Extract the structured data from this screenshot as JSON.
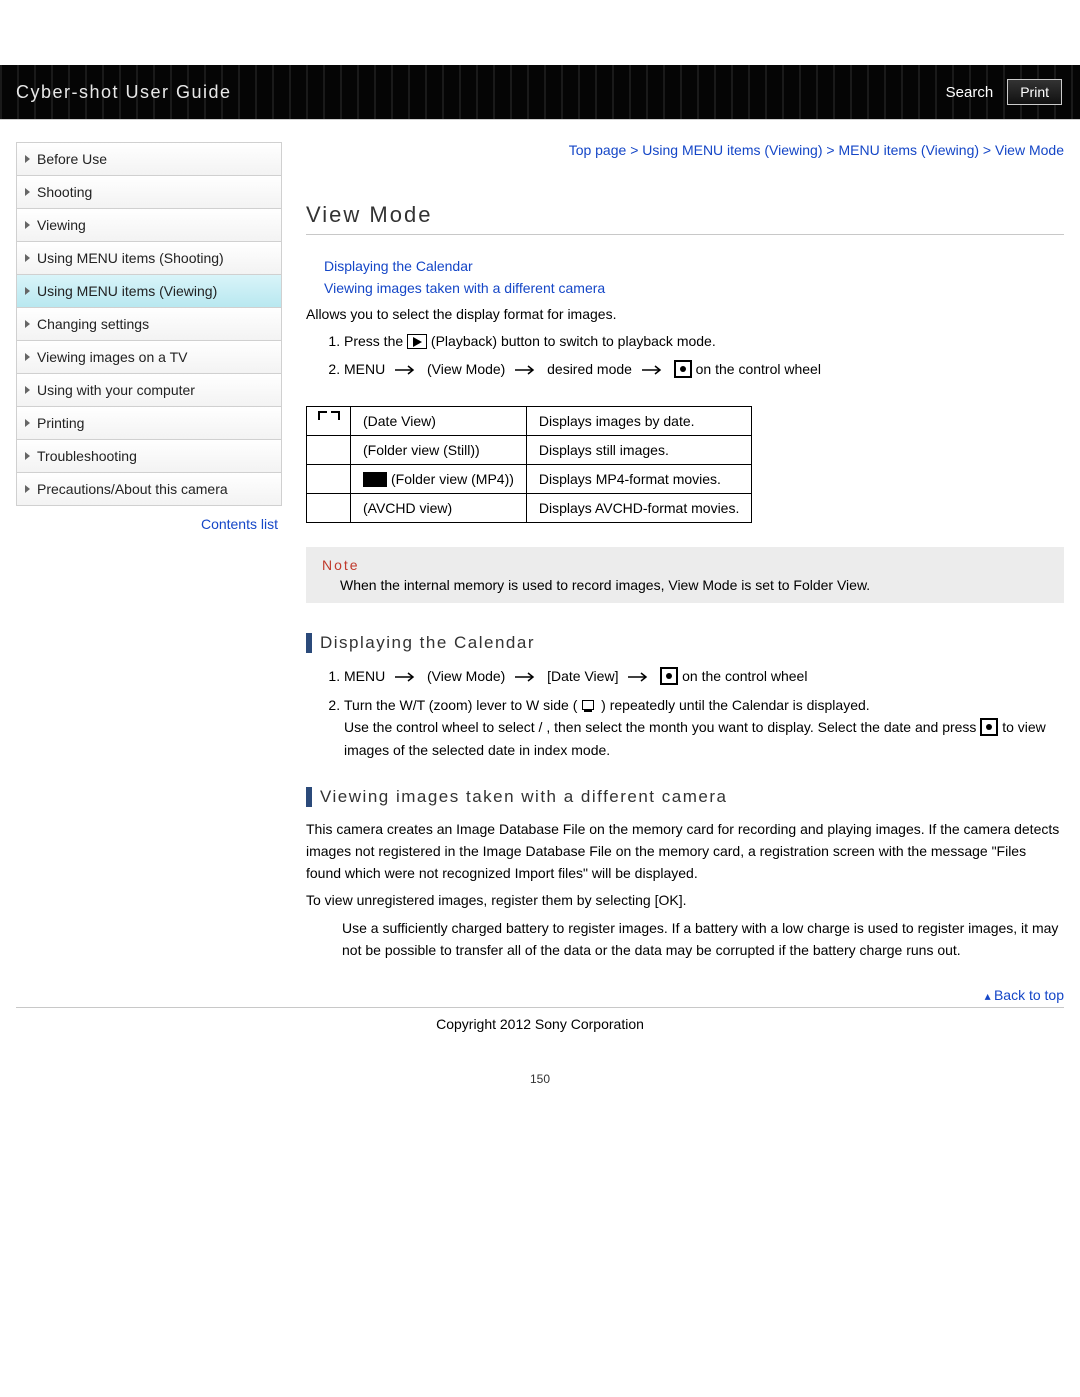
{
  "header": {
    "title": "Cyber-shot User Guide",
    "search": "Search",
    "print": "Print"
  },
  "breadcrumb": {
    "items": [
      "Top page",
      "Using MENU items (Viewing)",
      "MENU items (Viewing)",
      "View Mode"
    ]
  },
  "sidebar": {
    "items": [
      {
        "label": "Before Use",
        "active": false
      },
      {
        "label": "Shooting",
        "active": false
      },
      {
        "label": "Viewing",
        "active": false
      },
      {
        "label": "Using MENU items (Shooting)",
        "active": false
      },
      {
        "label": "Using MENU items (Viewing)",
        "active": true
      },
      {
        "label": "Changing settings",
        "active": false
      },
      {
        "label": "Viewing images on a TV",
        "active": false
      },
      {
        "label": "Using with your computer",
        "active": false
      },
      {
        "label": "Printing",
        "active": false
      },
      {
        "label": "Troubleshooting",
        "active": false
      },
      {
        "label": "Precautions/About this camera",
        "active": false
      }
    ],
    "contents_list": "Contents list"
  },
  "page_title": "View Mode",
  "anchors": {
    "a1": "Displaying the Calendar",
    "a2": "Viewing images taken with a different camera"
  },
  "intro": "Allows you to select the display format for images.",
  "steps_main": {
    "s1_a": "Press the ",
    "s1_b": " (Playback) button to switch to playback mode.",
    "s2_a": "MENU ",
    "s2_b": " (View Mode) ",
    "s2_c": " desired mode ",
    "s2_d": " on the control wheel"
  },
  "modes_table": {
    "rows": [
      {
        "name": "(Date View)",
        "desc": "Displays images by date."
      },
      {
        "name": "(Folder view (Still))",
        "desc": "Displays still images."
      },
      {
        "name": "(Folder view (MP4))",
        "desc": "Displays MP4-format movies."
      },
      {
        "name": "(AVCHD view)",
        "desc": "Displays AVCHD-format movies."
      }
    ]
  },
  "note": {
    "title": "Note",
    "body": "When the internal memory is used to record images, View Mode is set to Folder View."
  },
  "section_calendar": {
    "heading": "Displaying the Calendar",
    "s1_a": "MENU ",
    "s1_b": " (View Mode) ",
    "s1_c": " [Date View] ",
    "s1_d": " on the control wheel",
    "s2_a": "Turn the W/T (zoom) lever to W side ( ",
    "s2_b": ") repeatedly until the Calendar is displayed.",
    "s2_c": "Use the control wheel to select     /    , then select the month you want to display. Select the date and press ",
    "s2_d": " to view images of the selected date in index mode."
  },
  "section_diff": {
    "heading": "Viewing images taken with a different camera",
    "p1": "This camera creates an Image Database File on the memory card for recording and playing images. If the camera detects images not registered in the Image Database File on the memory card, a registration screen with the message \"Files found which were not recognized Import files\" will be displayed.",
    "p2": "To view unregistered images, register them by selecting [OK].",
    "p3": "Use a sufficiently charged battery to register images. If a battery with a low charge is used to register images, it may not be possible to transfer all of the data or the data may be corrupted if the battery charge runs out."
  },
  "back_to_top": "Back to top",
  "copyright": "Copyright 2012 Sony Corporation",
  "page_number": "150"
}
